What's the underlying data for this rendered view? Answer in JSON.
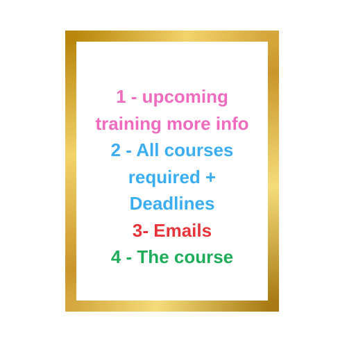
{
  "colors": {
    "frame_gold": "#c9a227",
    "pink": "#f06bbd",
    "blue": "#3aaef0",
    "red": "#e8333a",
    "green": "#1eac5a"
  },
  "items": [
    {
      "lines": [
        "1 - upcoming",
        "training more info"
      ],
      "color": "#f06bbd"
    },
    {
      "lines": [
        "2 - All courses",
        "required +",
        "Deadlines"
      ],
      "color": "#3aaef0"
    },
    {
      "lines": [
        "3- Emails"
      ],
      "color": "#e8333a"
    },
    {
      "lines": [
        "4 - The course"
      ],
      "color": "#1eac5a"
    }
  ]
}
